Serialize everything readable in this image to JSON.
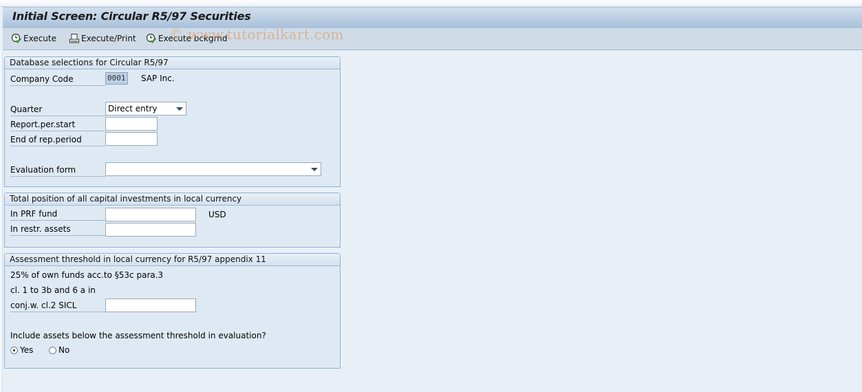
{
  "window": {
    "title": "Initial Screen: Circular R5/97 Securities"
  },
  "toolbar": {
    "buttons": [
      {
        "label": "Execute",
        "icon": "execute-clock-check-icon"
      },
      {
        "label": "Execute/Print",
        "icon": "printer-icon"
      },
      {
        "label": "Execute bckgrnd",
        "icon": "execute-clock-check-icon"
      }
    ]
  },
  "watermark": "© www.tutorialkart.com",
  "groups": {
    "database": {
      "title": "Database selections for Circular R5/97",
      "company_code": {
        "label": "Company Code",
        "value": "0001",
        "description": "SAP Inc."
      },
      "quarter": {
        "label": "Quarter",
        "selected": "Direct entry"
      },
      "report_start": {
        "label": "Report.per.start",
        "value": ""
      },
      "report_end": {
        "label": "End of rep.period",
        "value": ""
      },
      "evaluation_form": {
        "label": "Evaluation form",
        "selected": ""
      }
    },
    "total_position": {
      "title": "Total position of all capital investments in local currency",
      "prf_fund": {
        "label": "In PRF fund",
        "value": ""
      },
      "currency": "USD",
      "restr_assets": {
        "label": "In restr. assets",
        "value": ""
      }
    },
    "threshold": {
      "title": "Assessment threshold in local currency for R5/97 appendix 11",
      "line1": "25% of own funds acc.to §53c para.3",
      "line2": "cl. 1 to 3b and 6 a in",
      "conj": {
        "label": "conj.w. cl.2 SICL",
        "value": ""
      },
      "question": "Include assets below the assessment threshold in evaluation?",
      "options": [
        {
          "label": "Yes",
          "selected": true
        },
        {
          "label": "No",
          "selected": false
        }
      ]
    }
  }
}
